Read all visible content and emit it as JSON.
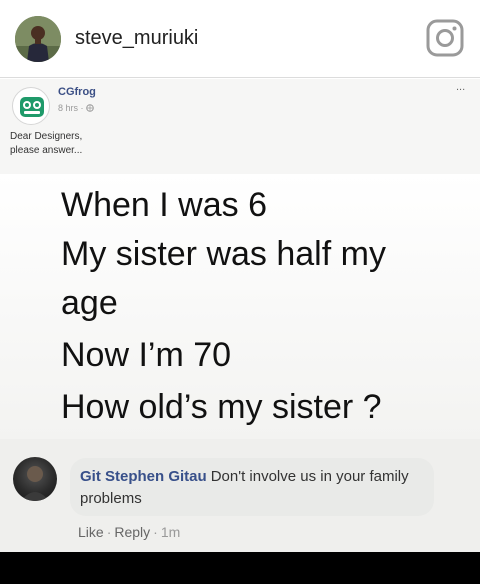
{
  "instagram": {
    "username": "steve_muriuki",
    "icon": "instagram-camera-icon"
  },
  "post": {
    "page_name": "CGfrog",
    "timestamp": "8 hrs",
    "privacy_icon": "globe-icon",
    "more_label": "...",
    "text_lines": [
      "Dear Designers,",
      "please answer..."
    ],
    "riddle_lines": [
      "When I was 6",
      "My sister was half my",
      "age",
      "Now I’m 70",
      "How old’s my sister ?"
    ]
  },
  "comment": {
    "author": "Git Stephen Gitau",
    "text": "Don't involve us in your family problems",
    "like_label": "Like",
    "reply_label": "Reply",
    "time": "1m"
  },
  "colors": {
    "link_blue": "#3b4f85",
    "page_logo_green": "#1f9a6a"
  }
}
